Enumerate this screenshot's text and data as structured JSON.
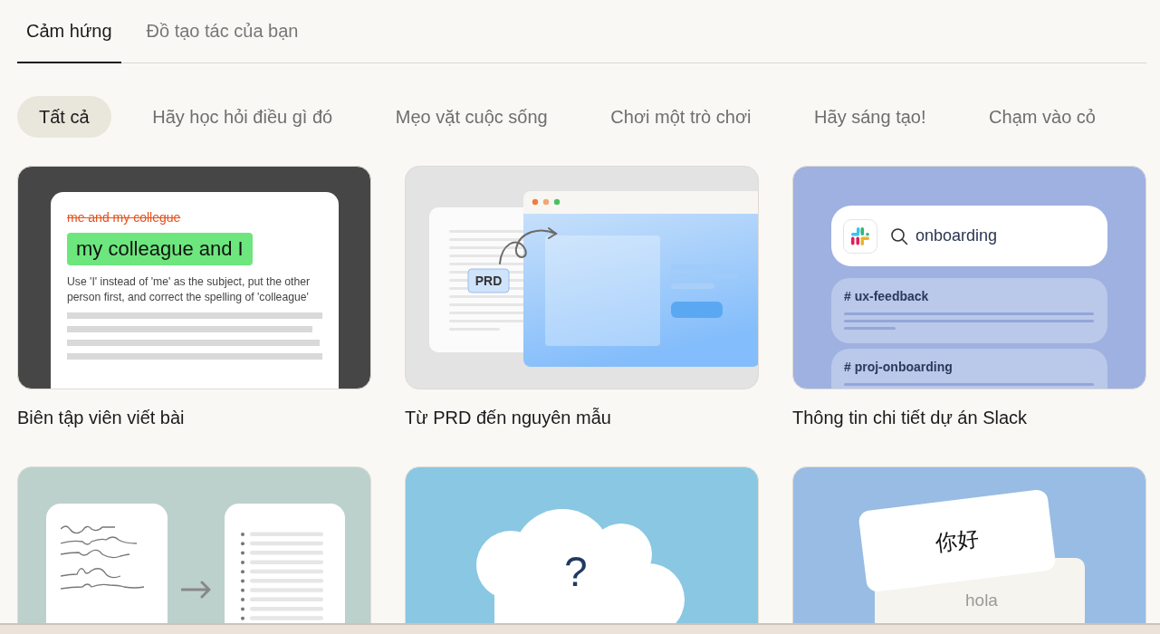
{
  "tabs": [
    {
      "label": "Cảm hứng",
      "selected": true
    },
    {
      "label": "Đồ tạo tác của bạn",
      "selected": false
    }
  ],
  "filters": [
    {
      "label": "Tất cả",
      "selected": true
    },
    {
      "label": "Hãy học hỏi điều gì đó",
      "selected": false
    },
    {
      "label": "Mẹo vặt cuộc sống",
      "selected": false
    },
    {
      "label": "Chơi một trò chơi",
      "selected": false
    },
    {
      "label": "Hãy sáng tạo!",
      "selected": false
    },
    {
      "label": "Chạm vào cỏ",
      "selected": false
    }
  ],
  "cards": [
    {
      "kind": "editor",
      "title": "Biên tập viên viết bài",
      "struck": "me and my collegue",
      "suggestion": "my colleague and I",
      "explanation": "Use 'I' instead of 'me' as the subject, put the other person first, and correct the spelling of 'colleague'"
    },
    {
      "kind": "prd",
      "title": "Từ PRD đến nguyên mẫu",
      "tag": "PRD"
    },
    {
      "kind": "slack",
      "title": "Thông tin chi tiết dự án Slack",
      "query": "onboarding",
      "channels": [
        "# ux-feedback",
        "# proj-onboarding"
      ]
    },
    {
      "kind": "notes"
    },
    {
      "kind": "question",
      "mark": "?"
    },
    {
      "kind": "flashcards",
      "front": "你好",
      "back": "hola"
    }
  ]
}
